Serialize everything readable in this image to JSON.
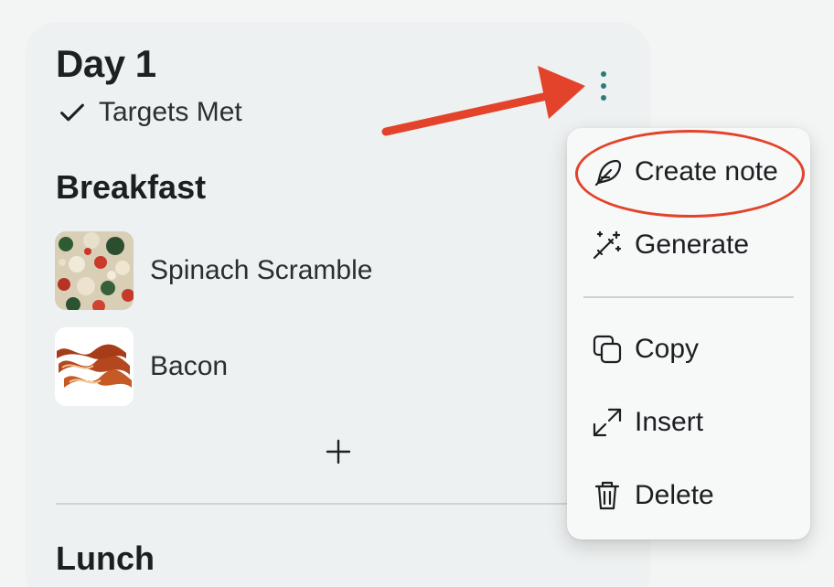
{
  "day": {
    "title": "Day 1",
    "status": "Targets Met"
  },
  "sections": {
    "breakfast": {
      "title": "Breakfast",
      "items": [
        {
          "name": "Spinach Scramble"
        },
        {
          "name": "Bacon"
        }
      ]
    },
    "lunch": {
      "title": "Lunch"
    }
  },
  "menu": {
    "items": [
      {
        "label": "Create note",
        "icon": "feather-icon"
      },
      {
        "label": "Generate",
        "icon": "magic-wand-icon"
      },
      {
        "label": "Copy",
        "icon": "copy-icon"
      },
      {
        "label": "Insert",
        "icon": "expand-arrows-icon"
      },
      {
        "label": "Delete",
        "icon": "trash-icon"
      }
    ]
  },
  "colors": {
    "accent": "#2f7a78",
    "annotation": "#e2432a",
    "card_bg": "#eef1f1",
    "page_bg": "#f3f5f5"
  }
}
